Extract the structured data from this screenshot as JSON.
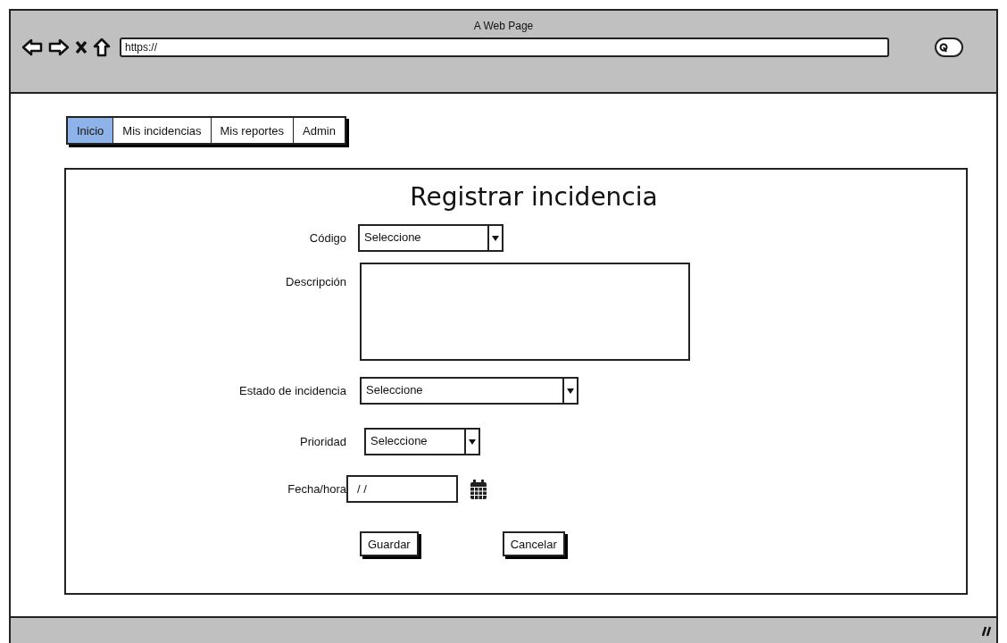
{
  "window": {
    "title": "A Web Page",
    "url": "https://"
  },
  "tabs": [
    {
      "label": "Inicio",
      "selected": true
    },
    {
      "label": "Mis incidencias",
      "selected": false
    },
    {
      "label": "Mis reportes",
      "selected": false
    },
    {
      "label": "Admin",
      "selected": false
    }
  ],
  "form": {
    "title": "Registrar incidencia",
    "fields": [
      {
        "kind": "select",
        "label": "Código",
        "value": "Seleccione"
      },
      {
        "kind": "textarea",
        "label": "Descripción"
      },
      {
        "kind": "select",
        "label": "Estado de incidencia",
        "value": "Seleccione"
      },
      {
        "kind": "select",
        "label": "Prioridad",
        "value": "Seleccione"
      },
      {
        "kind": "date",
        "label": "Fecha/hora",
        "value": "/ /"
      }
    ],
    "buttons": [
      "Guardar",
      "Cancelar"
    ]
  }
}
